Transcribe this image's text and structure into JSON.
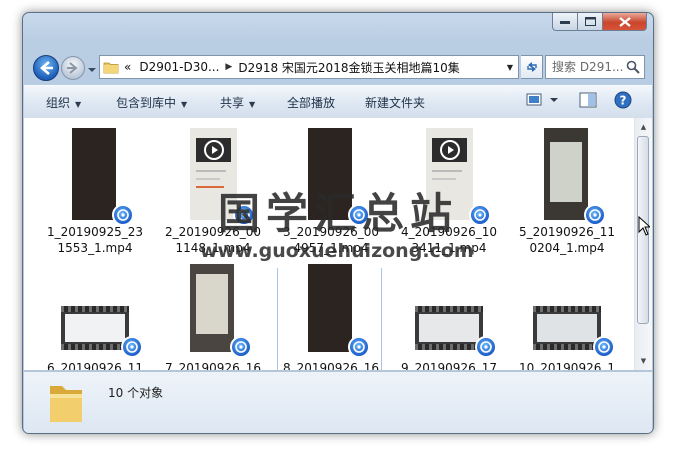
{
  "window": {
    "caption": {
      "minimize": "minimize",
      "maximize": "maximize",
      "close": "close"
    }
  },
  "address": {
    "overflow": "«",
    "segments": [
      "D2901-D30...",
      "D2918 宋国元2018金锁玉关相地篇10集"
    ],
    "search_placeholder": "搜索 D291..."
  },
  "toolbar": {
    "organize": "组织",
    "include_in_library": "包含到库中",
    "share": "共享",
    "play_all": "全部播放",
    "new_folder": "新建文件夹"
  },
  "files": [
    {
      "name": "1_20190925_231553_1.mp4",
      "line1": "1_20190925_23",
      "line2": "1553_1.mp4"
    },
    {
      "name": "2_20190926_001148_1.mp4",
      "line1": "2_20190926_00",
      "line2": "1148_1.mp4"
    },
    {
      "name": "3_20190926_004957_1.mp4",
      "line1": "3_20190926_00",
      "line2": "4957_1.mp4"
    },
    {
      "name": "4_20190926_103411_1.mp4",
      "line1": "4_20190926_10",
      "line2": "3411_1.mp4"
    },
    {
      "name": "5_20190926_110204_1.mp4",
      "line1": "5_20190926_11",
      "line2": "0204_1.mp4"
    },
    {
      "name": "6_20190926_11",
      "line1": "6_20190926_11",
      "line2": ""
    },
    {
      "name": "7_20190926_16",
      "line1": "7_20190926_16",
      "line2": ""
    },
    {
      "name": "8_20190926_16",
      "line1": "8_20190926_16",
      "line2": ""
    },
    {
      "name": "9_20190926_17",
      "line1": "9_20190926_17",
      "line2": ""
    },
    {
      "name": "10_20190926_1",
      "line1": "10_20190926_1",
      "line2": ""
    }
  ],
  "status": {
    "count": "10 个对象"
  },
  "watermark": {
    "chinese": "国学汇总站",
    "url": "www.guoxuehuizong.com"
  },
  "colors": {
    "accent": "#1b5ec9",
    "chrome": "#b9cde3"
  }
}
